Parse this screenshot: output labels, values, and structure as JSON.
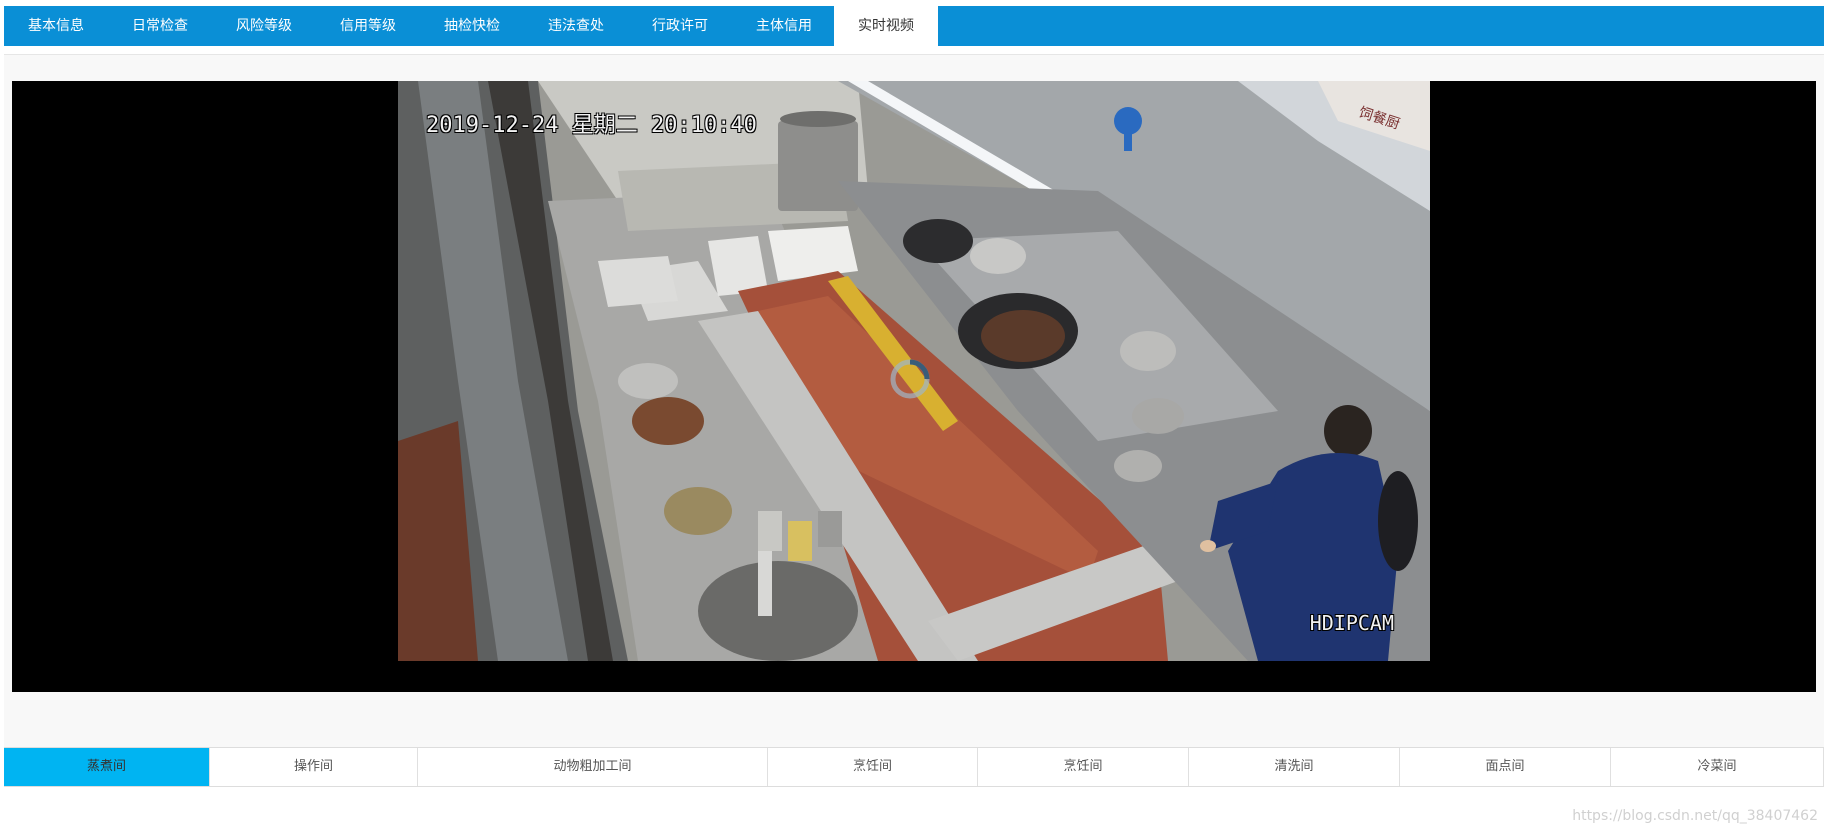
{
  "tabs": [
    {
      "label": "基本信息"
    },
    {
      "label": "日常检查"
    },
    {
      "label": "风险等级"
    },
    {
      "label": "信用等级"
    },
    {
      "label": "抽检快检"
    },
    {
      "label": "违法查处"
    },
    {
      "label": "行政许可"
    },
    {
      "label": "主体信用"
    },
    {
      "label": "实时视频",
      "active": true
    }
  ],
  "video": {
    "timestamp": "2019-12-24 星期二 20:10:40",
    "camera_label": "HDIPCAM",
    "signage_text": "饲餐厨"
  },
  "rooms": [
    {
      "label": "蒸煮间",
      "active": true
    },
    {
      "label": "操作间"
    },
    {
      "label": "动物粗加工间"
    },
    {
      "label": "烹饪间"
    },
    {
      "label": "烹饪间"
    },
    {
      "label": "清洗间"
    },
    {
      "label": "面点间"
    },
    {
      "label": "冷菜间"
    }
  ],
  "watermark": "https://blog.csdn.net/qq_38407462",
  "colors": {
    "tabbar": "#0a8fd6",
    "room_active": "#00b4f2"
  }
}
